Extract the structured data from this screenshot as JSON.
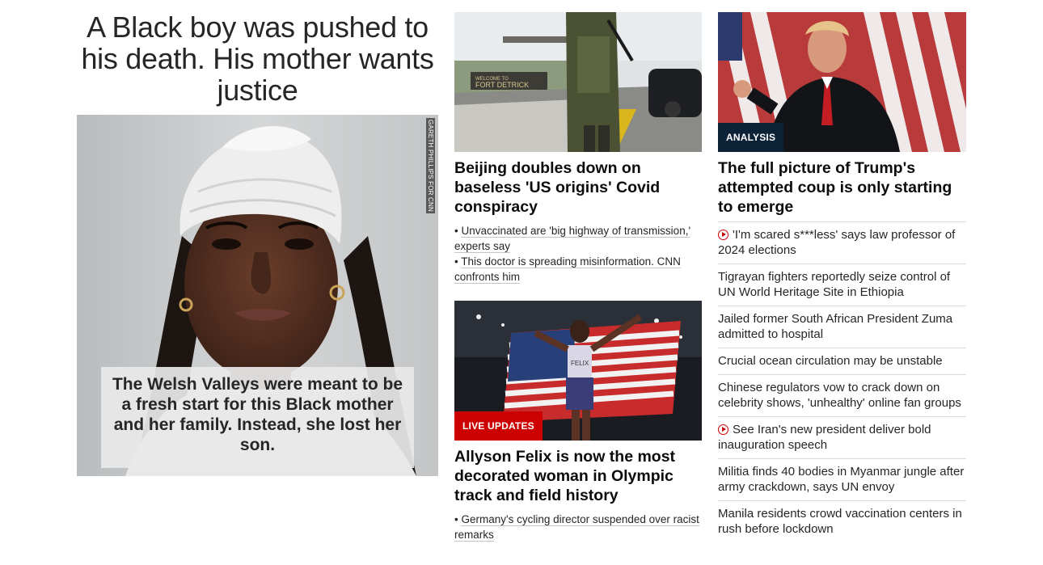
{
  "lead": {
    "title": "A Black boy was pushed to his death. His mother wants justice",
    "photo_credit": "GARETH PHILLIPS FOR CNN",
    "caption": "The Welsh Valleys were meant to be a fresh start for this Black mother and her family. Instead, she lost her son."
  },
  "column2": {
    "story1": {
      "image_sign": "WELCOME TO\nFORT DETRICK",
      "headline": "Beijing doubles down on baseless 'US origins' Covid conspiracy",
      "bullets": [
        "Unvaccinated are 'big highway of transmission,' experts say",
        "This doctor is spreading misinformation. CNN confronts him"
      ]
    },
    "story2": {
      "badge": "LIVE UPDATES",
      "headline": "Allyson Felix is now the most decorated woman in Olympic track and field history",
      "bullets": [
        "Germany's cycling director suspended over racist remarks"
      ]
    }
  },
  "column3": {
    "lead": {
      "badge": "ANALYSIS",
      "headline": "The full picture of Trump's attempted coup is only starting to emerge"
    },
    "items": [
      {
        "text": "'I'm scared s***less' says law professor of 2024 elections",
        "video": true
      },
      {
        "text": "Tigrayan fighters reportedly seize control of UN World Heritage Site in Ethiopia",
        "video": false
      },
      {
        "text": "Jailed former South African President Zuma admitted to hospital",
        "video": false
      },
      {
        "text": "Crucial ocean circulation may be unstable",
        "video": false
      },
      {
        "text": "Chinese regulators vow to crack down on celebrity shows, 'unhealthy' online fan groups",
        "video": false
      },
      {
        "text": "See Iran's new president deliver bold inauguration speech",
        "video": true
      },
      {
        "text": "Militia finds 40 bodies in Myanmar jungle after army crackdown, says UN envoy",
        "video": false
      },
      {
        "text": "Manila residents crowd vaccination centers in rush before lockdown",
        "video": false
      }
    ]
  },
  "colors": {
    "accent_red": "#cc0000",
    "analysis_navy": "#0c2236",
    "headline_text": "#0c0c0c"
  }
}
